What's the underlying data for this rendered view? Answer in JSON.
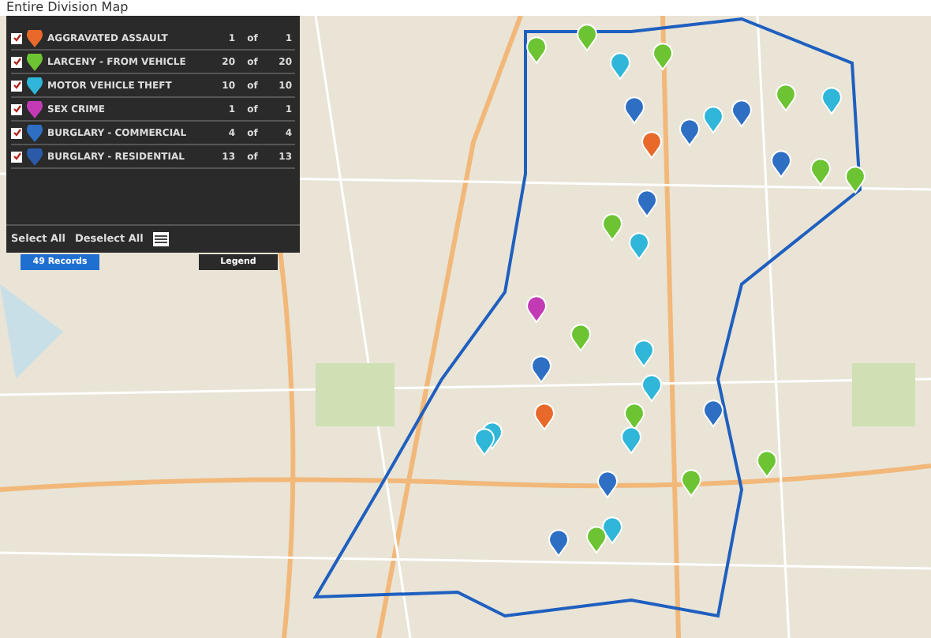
{
  "title": "Entire Division Map",
  "layers": [
    {
      "checked": true,
      "name": "AGGRAVATED ASSAULT",
      "count": "1",
      "of": "of",
      "total": "1",
      "color": "#e8692a"
    },
    {
      "checked": true,
      "name": "LARCENY - FROM VEHICLE",
      "count": "20",
      "of": "of",
      "total": "20",
      "color": "#6cc433"
    },
    {
      "checked": true,
      "name": "MOTOR VEHICLE THEFT",
      "count": "10",
      "of": "of",
      "total": "10",
      "color": "#2fb6d8"
    },
    {
      "checked": true,
      "name": "SEX CRIME",
      "count": "1",
      "of": "of",
      "total": "1",
      "color": "#c23bb5"
    },
    {
      "checked": true,
      "name": "BURGLARY - COMMERCIAL",
      "count": "4",
      "of": "of",
      "total": "4",
      "color": "#2e6fc4"
    },
    {
      "checked": true,
      "name": "BURGLARY - RESIDENTIAL",
      "count": "13",
      "of": "of",
      "total": "13",
      "color": "#2a5aa8"
    }
  ],
  "actions": [
    "Select All",
    "Deselect All"
  ],
  "tabs": [
    {
      "label": "49 Records",
      "selected": true
    },
    {
      "label": "Legend",
      "selected": false
    }
  ]
}
